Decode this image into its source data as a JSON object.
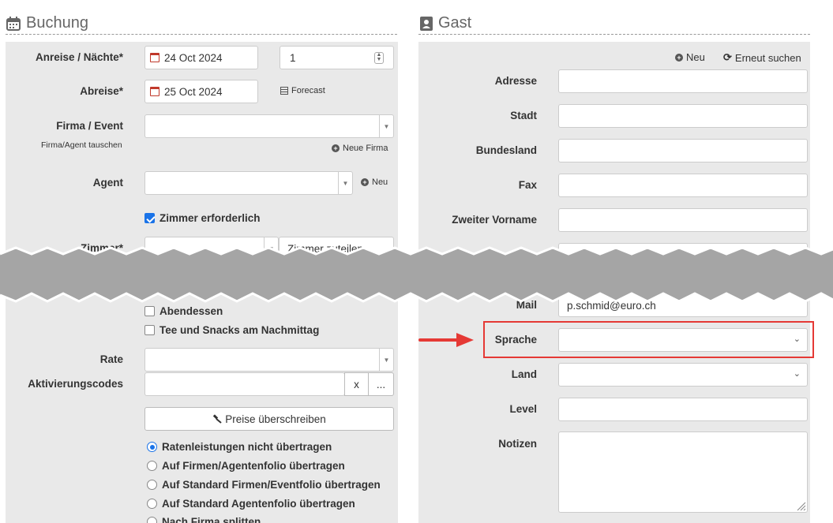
{
  "booking": {
    "title": "Buchung",
    "arrival_label": "Anreise / Nächte*",
    "arrival_value": "24 Oct 2024",
    "nights_value": "1",
    "departure_label": "Abreise*",
    "departure_value": "25 Oct 2024",
    "forecast_label": "Forecast",
    "company_label": "Firma / Event",
    "swap_agent_label": "Firma/Agent tauschen",
    "new_company_label": "Neue Firma",
    "agent_label": "Agent",
    "agent_new_label": "Neu",
    "room_required_label": "Zimmer erforderlich",
    "room_label_partial": "Zimmer*",
    "room_assign_partial": "Zimmer zuteilen",
    "dinner_label": "Abendessen",
    "tea_label": "Tee und Snacks am Nachmittag",
    "rate_label": "Rate",
    "activation_label": "Aktivierungscodes",
    "activation_clear": "x",
    "activation_more": "...",
    "override_prices_label": "Preise überschreiben",
    "radio_options": [
      "Ratenleistungen nicht übertragen",
      "Auf Firmen/Agentenfolio übertragen",
      "Auf Standard Firmen/Eventfolio übertragen",
      "Auf Standard Agentenfolio übertragen",
      "Nach Firma splitten"
    ]
  },
  "guest": {
    "title": "Gast",
    "new_label": "Neu",
    "search_again_label": "Erneut suchen",
    "address_label": "Adresse",
    "city_label": "Stadt",
    "state_label": "Bundesland",
    "fax_label": "Fax",
    "middle_name_label": "Zweiter Vorname",
    "mail_label_partial": "Mail",
    "mail_value_partial": "p.schmid@euro.ch",
    "language_label": "Sprache",
    "country_label": "Land",
    "level_label": "Level",
    "notes_label": "Notizen"
  },
  "colors": {
    "panel_bg": "#e9e9e9",
    "highlight": "#e53935",
    "accent_blue": "#1a73e8"
  }
}
